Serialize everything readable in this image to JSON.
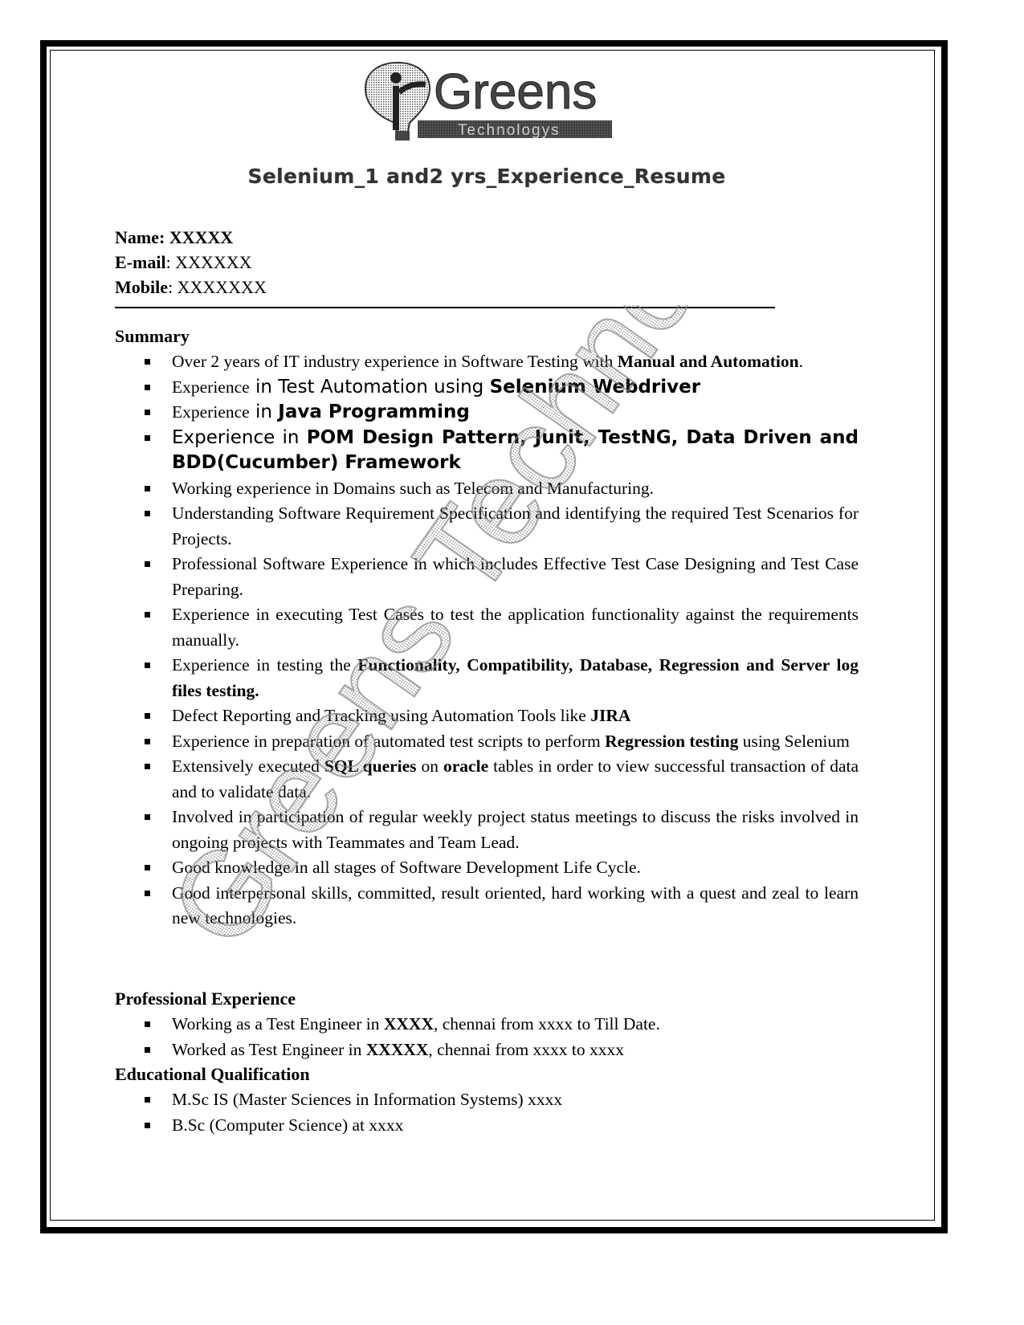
{
  "brand": {
    "logo_name": "Greens",
    "logo_tagline": "Technologys",
    "watermark": "Greens Technologys"
  },
  "document": {
    "title": "Selenium_1 and2 yrs_Experience_Resume"
  },
  "contact": {
    "name_label": "Name:",
    "name_value": "XXXXX",
    "email_label": "E-mail",
    "email_value": ": XXXXXX",
    "mobile_label": "Mobile",
    "mobile_value": ": XXXXXXX"
  },
  "summary": {
    "heading": "Summary",
    "items": [
      {
        "parts": [
          "Over 2 years of IT industry experience in Software Testing with ",
          "Manual and Automation",
          "."
        ]
      },
      {
        "parts": [
          "Experience",
          " in Test Automation using ",
          "Selenium Webdriver"
        ]
      },
      {
        "parts": [
          "Experience",
          " in ",
          "Java  Programming"
        ]
      },
      {
        "parts": [
          "Experience in ",
          "POM  Design Pattern, Junit, TestNG, Data Driven and BDD(Cucumber) Framework"
        ]
      },
      {
        "parts": [
          "Working experience in Domains such as Telecom and Manufacturing."
        ]
      },
      {
        "parts": [
          "Understanding Software Requirement Specification and identifying the required Test Scenarios for Projects."
        ]
      },
      {
        "parts": [
          "Professional Software Experience in which includes Effective Test Case Designing and Test Case Preparing."
        ]
      },
      {
        "parts": [
          "Experience in executing Test Cases to test the application functionality against the requirements manually."
        ]
      },
      {
        "parts": [
          "Experience in testing the ",
          "Functionality, Compatibility, Database, Regression and Server log files testing."
        ]
      },
      {
        "parts": [
          "Defect Reporting and Tracking using Automation Tools like ",
          "JIRA"
        ]
      },
      {
        "parts": [
          "Experience in preparation of automated test scripts to perform ",
          "Regression testing",
          " using Selenium"
        ]
      },
      {
        "parts": [
          "Extensively executed ",
          "SQL queries",
          " on ",
          "oracle",
          " tables in order to view successful transaction of data and to validate data."
        ]
      },
      {
        "parts": [
          "Involved in participation of regular weekly project status meetings to discuss the risks involved in ongoing projects with Teammates and Team Lead."
        ]
      },
      {
        "parts": [
          "Good knowledge in all stages of Software Development Life Cycle."
        ]
      },
      {
        "parts": [
          "Good interpersonal skills, committed, result oriented, hard working with a quest and zeal to learn new technologies."
        ]
      }
    ]
  },
  "experience": {
    "heading": "Professional Experience",
    "items": [
      {
        "parts": [
          "Working as a Test Engineer in ",
          "XXXX",
          ", chennai from xxxx  to Till Date."
        ]
      },
      {
        "parts": [
          "Worked as Test Engineer in ",
          "XXXXX",
          ", chennai from xxxx to xxxx"
        ]
      }
    ]
  },
  "education": {
    "heading": "Educational Qualification",
    "items": [
      {
        "parts": [
          "M.Sc IS (Master Sciences in Information Systems) xxxx"
        ]
      },
      {
        "parts": [
          "B.Sc (Computer Science) at xxxx"
        ]
      }
    ]
  }
}
